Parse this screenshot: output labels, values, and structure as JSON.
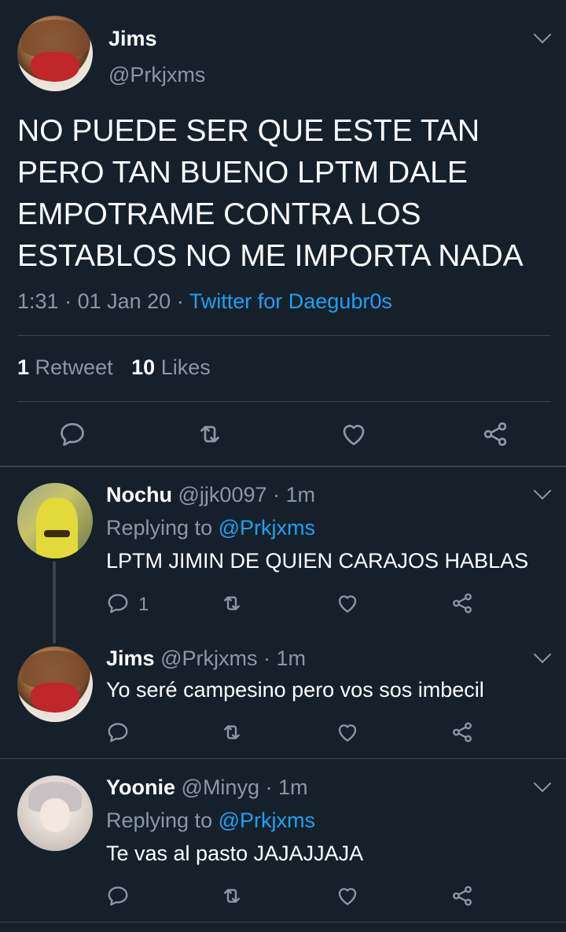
{
  "main_tweet": {
    "author_name": "Jims",
    "author_handle": "@Prkjxms",
    "text_lines": [
      "NO PUEDE SER QUE ESTE TAN",
      "PERO TAN BUENO LPTM DALE",
      "EMPOTRAME CONTRA LOS",
      "ESTABLOS NO ME IMPORTA NADA"
    ],
    "time": "1:31",
    "date": "01 Jan 20",
    "source": "Twitter for Daegubr0s",
    "retweet_count": "1",
    "retweet_label": "Retweet",
    "like_count": "10",
    "like_label": "Likes"
  },
  "replies": [
    {
      "name": "Nochu",
      "handle": "@jjk0097",
      "age": "1m",
      "replying_label": "Replying to",
      "replying_to": "@Prkjxms",
      "text": "LPTM JIMIN DE QUIEN CARAJOS HABLAS",
      "reply_count": "1"
    },
    {
      "name": "Jims",
      "handle": "@Prkjxms",
      "age": "1m",
      "text": "Yo seré campesino pero vos sos imbecil"
    },
    {
      "name": "Yoonie",
      "handle": "@Minyg",
      "age": "1m",
      "replying_label": "Replying to",
      "replying_to": "@Prkjxms",
      "text": "Te vas al pasto JAJAJJAJA"
    }
  ],
  "separator": "·",
  "colors": {
    "background": "#15202b",
    "muted": "#8899a6",
    "accent": "#1da1f2",
    "divider": "#38444d"
  },
  "icons": [
    "reply-icon",
    "retweet-icon",
    "like-icon",
    "share-icon",
    "chevron-down-icon"
  ]
}
